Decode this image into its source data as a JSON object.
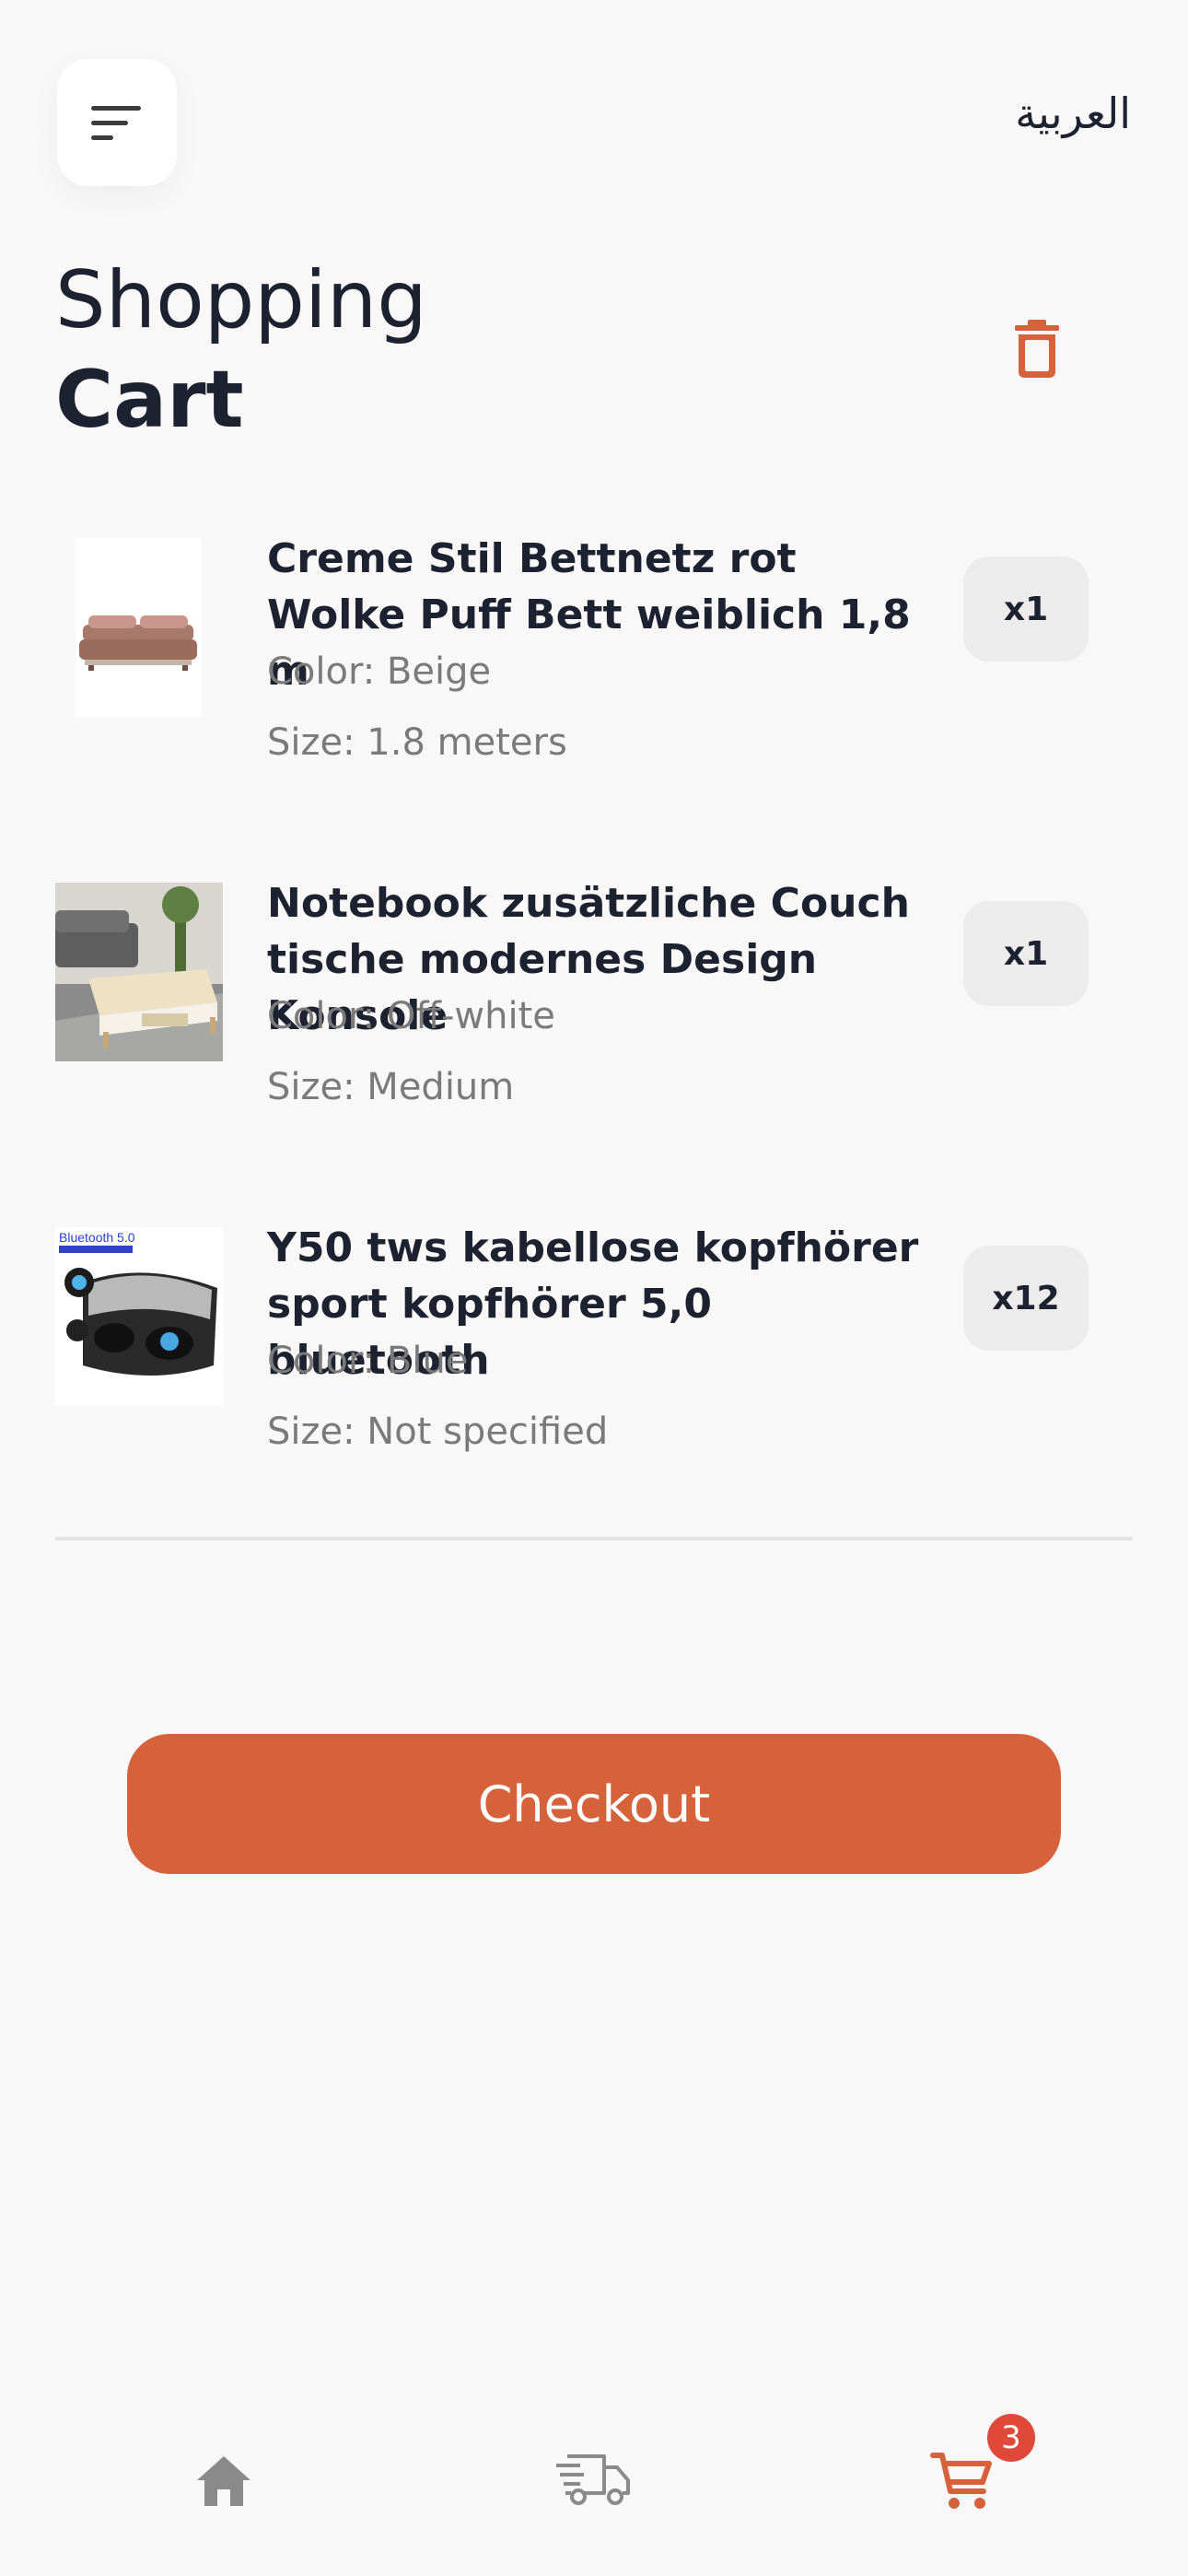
{
  "header": {
    "language_label": "العربية",
    "title_line1": "Shopping",
    "title_line2": "Cart"
  },
  "cart": {
    "items": [
      {
        "name": "Creme Stil Bettnetz rot Wolke Puff Bett weiblich 1,8 m",
        "color": "Color: Beige",
        "size": "Size: 1.8 meters",
        "quantity": "x1",
        "image": "bed-image"
      },
      {
        "name": "Notebook zusätzliche Couch tische modernes Design Konsole",
        "color": "Color: Off-white",
        "size": "Size: Medium",
        "quantity": "x1",
        "image": "coffee-table-image"
      },
      {
        "name": "Y50 tws kabellose kopfhörer sport kopfhörer 5,0 bluetooth",
        "color": "Color: Blue",
        "size": "Size: Not specified",
        "quantity": "x12",
        "image": "earbuds-image",
        "image_text": "Bluetooth 5.0"
      }
    ]
  },
  "checkout_label": "Checkout",
  "bottom_nav": {
    "items": [
      {
        "icon": "home-icon",
        "active": false
      },
      {
        "icon": "delivery-truck-icon",
        "active": false
      },
      {
        "icon": "cart-icon",
        "active": true
      }
    ],
    "cart_badge": "3"
  },
  "colors": {
    "accent": "#d5623a",
    "badge": "#e0483a",
    "text": "#1d2230",
    "muted": "#7a7a7a",
    "nav_inactive": "#8a8a8a"
  }
}
